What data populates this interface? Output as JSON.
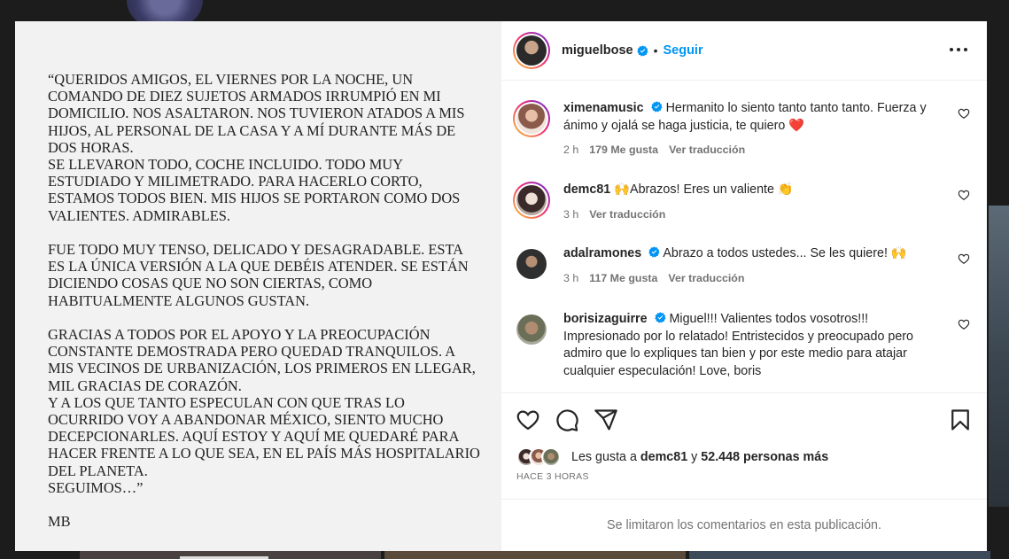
{
  "post": {
    "statement_text": "“QUERIDOS AMIGOS, EL VIERNES POR LA NOCHE, UN COMANDO DE DIEZ SUJETOS ARMADOS IRRUMPIÓ EN MI DOMICILIO. NOS ASALTARON. NOS TUVIERON ATADOS A MIS HIJOS, AL PERSONAL DE LA CASA Y A MÍ DURANTE MÁS DE DOS HORAS.\nSE LLEVARON TODO, COCHE INCLUIDO. TODO MUY ESTUDIADO Y MILIMETRADO. PARA HACERLO CORTO, ESTAMOS TODOS BIEN. MIS HIJOS SE PORTARON COMO DOS VALIENTES. ADMIRABLES.\n\nFUE TODO MUY TENSO, DELICADO Y DESAGRADABLE. ESTA ES LA ÚNICA VERSIÓN A LA QUE DEBÉIS ATENDER. SE ESTÁN DICIENDO COSAS QUE NO SON CIERTAS, COMO HABITUALMENTE ALGUNOS GUSTAN.\n\nGRACIAS A TODOS POR EL APOYO Y LA PREOCUPACIÓN CONSTANTE DEMOSTRADA PERO QUEDAD TRANQUILOS. A MIS VECINOS DE URBANIZACIÓN, LOS PRIMEROS EN LLEGAR, MIL GRACIAS DE CORAZÓN.\nY A LOS QUE TANTO ESPECULAN CON QUE TRAS LO OCURRIDO VOY A ABANDONAR MÉXICO, SIENTO MUCHO DECEPCIONARLES. AQUÍ ESTOY Y AQUÍ ME QUEDARÉ PARA HACER FRENTE A LO QUE SEA, EN EL PAÍS MÁS HOSPITALARIO DEL PLANETA.\nSEGUIMOS…”",
    "signature": "MB"
  },
  "header": {
    "username": "miguelbose",
    "separator": "•",
    "follow_label": "Seguir"
  },
  "comments": [
    {
      "username": "ximenamusic",
      "verified": true,
      "text": "Hermanito lo siento tanto tanto tanto. Fuerza y ánimo y ojalá se haga justicia, te quiero ❤️",
      "time": "2 h",
      "likes": "179 Me gusta",
      "translate": "Ver traducción"
    },
    {
      "username": "demc81",
      "verified": false,
      "text": "🙌Abrazos! Eres un valiente 👏",
      "time": "3 h",
      "likes": "",
      "translate": "Ver traducción"
    },
    {
      "username": "adalramones",
      "verified": true,
      "text": "Abrazo a todos ustedes... Se les quiere! 🙌",
      "time": "3 h",
      "likes": "117 Me gusta",
      "translate": "Ver traducción"
    },
    {
      "username": "borisizaguirre",
      "verified": true,
      "text": "Miguel!!! Valientes todos vosotros!!! Impresionado por lo relatado! Entristecidos y preocupado pero admiro que lo expliques tan bien y por este medio para atajar cualquier especulación! Love, boris"
    }
  ],
  "likes": {
    "prefix": "Les gusta a",
    "first_user": "demc81",
    "connector": "y",
    "count_text": "52.448 personas más"
  },
  "time_ago": "HACE 3 HORAS",
  "footer_text": "Se limitaron los comentarios en esta publicación.",
  "colors": {
    "accent": "#0095f6",
    "verified": "#0095f6",
    "muted": "#737373",
    "heart_red": "#ed4956"
  },
  "icons": [
    "more-icon",
    "heart-icon",
    "comment-icon",
    "share-icon",
    "save-icon",
    "verified-icon"
  ]
}
